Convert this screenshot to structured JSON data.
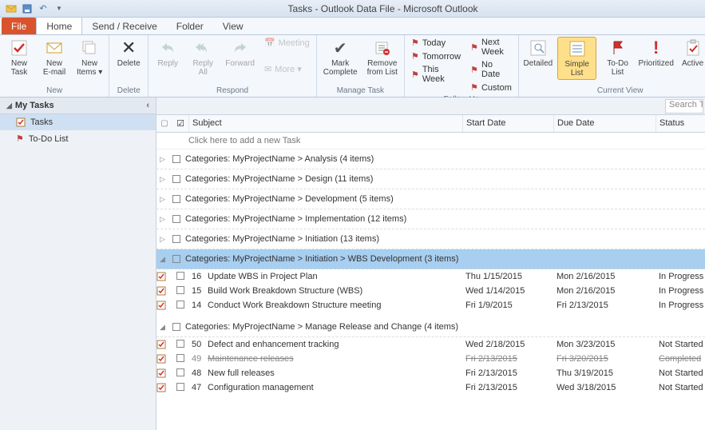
{
  "titlebar": {
    "title": "Tasks - Outlook Data File - Microsoft Outlook"
  },
  "tabs": {
    "file": "File",
    "home": "Home",
    "sendreceive": "Send / Receive",
    "folder": "Folder",
    "view": "View"
  },
  "ribbon": {
    "new": {
      "label": "New",
      "new_task": "New\nTask",
      "new_email": "New\nE-mail",
      "new_items": "New\nItems ▾"
    },
    "delete": {
      "label": "Delete",
      "delete": "Delete"
    },
    "respond": {
      "label": "Respond",
      "reply": "Reply",
      "reply_all": "Reply\nAll",
      "forward": "Forward",
      "meeting": "Meeting",
      "more": "More ▾"
    },
    "manage": {
      "label": "Manage Task",
      "mark": "Mark\nComplete",
      "remove": "Remove\nfrom List"
    },
    "followup": {
      "label": "Follow Up",
      "today": "Today",
      "tomorrow": "Tomorrow",
      "thisweek": "This Week",
      "nextweek": "Next Week",
      "nodate": "No Date",
      "custom": "Custom"
    },
    "currentview": {
      "label": "Current View",
      "detailed": "Detailed",
      "simple": "Simple List",
      "todo": "To-Do List",
      "prioritized": "Prioritized",
      "active": "Active"
    }
  },
  "nav": {
    "header": "My Tasks",
    "tasks": "Tasks",
    "todo": "To-Do List"
  },
  "search": {
    "placeholder": "Search Tas"
  },
  "columns": {
    "subject": "Subject",
    "start": "Start Date",
    "due": "Due Date",
    "status": "Status"
  },
  "newtask_hint": "Click here to add a new Task",
  "groups": [
    {
      "label": "Categories: MyProjectName > Analysis (4 items)",
      "expanded": false
    },
    {
      "label": "Categories: MyProjectName > Design (11 items)",
      "expanded": false
    },
    {
      "label": "Categories: MyProjectName > Development (5 items)",
      "expanded": false
    },
    {
      "label": "Categories: MyProjectName > Implementation (12 items)",
      "expanded": false
    },
    {
      "label": "Categories: MyProjectName > Initiation (13 items)",
      "expanded": false
    },
    {
      "label": "Categories: MyProjectName > Initiation > WBS Development (3 items)",
      "expanded": true,
      "selected": true,
      "rows": [
        {
          "num": "16",
          "subject": "Update WBS in Project Plan",
          "start": "Thu 1/15/2015",
          "due": "Mon 2/16/2015",
          "status": "In Progress"
        },
        {
          "num": "15",
          "subject": "Build Work Breakdown Structure (WBS)",
          "start": "Wed 1/14/2015",
          "due": "Mon 2/16/2015",
          "status": "In Progress"
        },
        {
          "num": "14",
          "subject": "Conduct Work Breakdown Structure meeting",
          "start": "Fri 1/9/2015",
          "due": "Fri 2/13/2015",
          "status": "In Progress"
        }
      ]
    },
    {
      "label": "Categories: MyProjectName > Manage Release and Change (4 items)",
      "expanded": true,
      "rows": [
        {
          "num": "50",
          "subject": "Defect and enhancement tracking",
          "start": "Wed 2/18/2015",
          "due": "Mon 3/23/2015",
          "status": "Not Started"
        },
        {
          "num": "49",
          "subject": "Maintenance releases",
          "start": "Fri 2/13/2015",
          "due": "Fri 3/20/2015",
          "status": "Completed",
          "done": true
        },
        {
          "num": "48",
          "subject": "New full releases",
          "start": "Fri 2/13/2015",
          "due": "Thu 3/19/2015",
          "status": "Not Started"
        },
        {
          "num": "47",
          "subject": "Configuration management",
          "start": "Fri 2/13/2015",
          "due": "Wed 3/18/2015",
          "status": "Not Started"
        }
      ]
    }
  ]
}
